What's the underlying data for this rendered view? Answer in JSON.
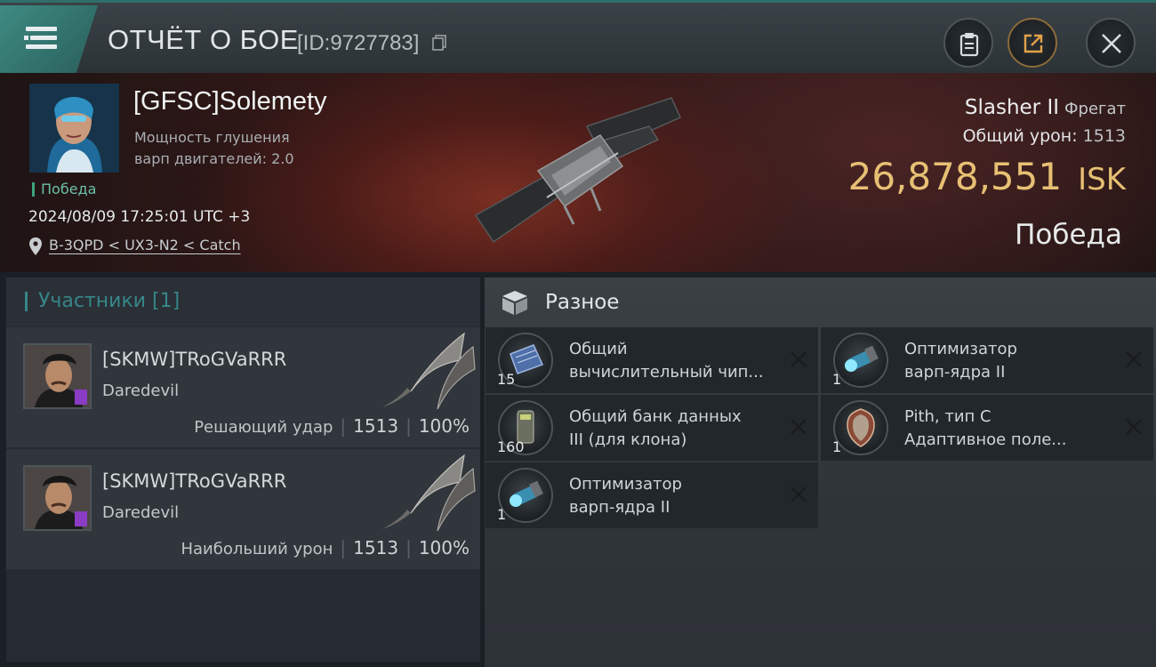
{
  "header": {
    "title": "ОТЧЁТ О БОЕ",
    "battle_id": "[ID:9727783]"
  },
  "victim": {
    "name": "[GFSC]Solemety",
    "stat_line1": "Мощность глушения",
    "stat_line2": "варп двигателей:  2.0",
    "status": "Победа",
    "datetime": "2024/08/09 17:25:01 UTC +3",
    "location": "B-3QPD < UX3-N2 < Catch",
    "ship_name": "Slasher II",
    "ship_class": "Фрегат",
    "total_damage_label": "Общий урон:",
    "total_damage": "1513",
    "isk_value": "26,878,551",
    "isk_unit": "ISK",
    "result": "Победа"
  },
  "participants": {
    "title": "Участники [1]",
    "rows": [
      {
        "name": "[SKMW]TRoGVaRRR",
        "ship": "Daredevil",
        "role": "Решающий удар",
        "damage": "1513",
        "percent": "100%"
      },
      {
        "name": "[SKMW]TRoGVaRRR",
        "ship": "Daredevil",
        "role": "Наибольший урон",
        "damage": "1513",
        "percent": "100%"
      }
    ]
  },
  "misc": {
    "title": "Разное",
    "items": [
      {
        "qty": "15",
        "line1": "Общий",
        "line2": "вычислительный чип...",
        "icon": "chip-icon"
      },
      {
        "qty": "1",
        "line1": "Оптимизатор",
        "line2": "варп-ядра II",
        "icon": "warp-core-optimizer-icon"
      },
      {
        "qty": "160",
        "line1": "Общий банк данных",
        "line2": "III (для клона)",
        "icon": "data-bank-icon"
      },
      {
        "qty": "1",
        "line1": "Pith, тип C",
        "line2": "Адаптивное поле...",
        "icon": "adaptive-field-icon"
      },
      {
        "qty": "1",
        "line1": "Оптимизатор",
        "line2": "варп-ядра II",
        "icon": "warp-core-optimizer-icon"
      }
    ]
  },
  "colors": {
    "accent": "#36868a",
    "isk": "#e7c074",
    "win": "#3fa37c"
  }
}
